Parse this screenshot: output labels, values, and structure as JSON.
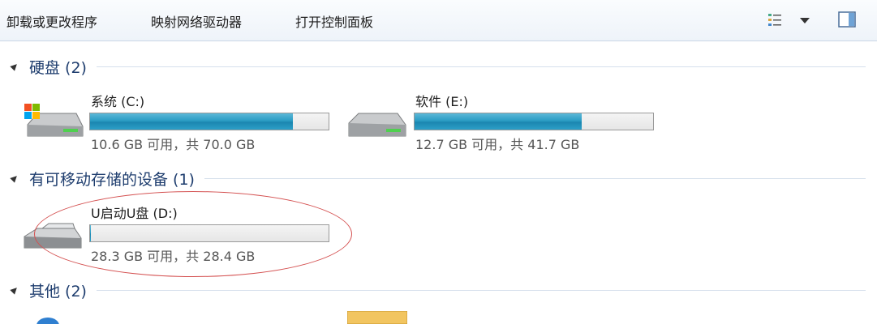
{
  "toolbar": {
    "uninstall": "卸载或更改程序",
    "map_drive": "映射网络驱动器",
    "control_panel": "打开控制面板"
  },
  "groups": {
    "hard_disk": "硬盘 (2)",
    "removable": "有可移动存储的设备 (1)",
    "other": "其他 (2)"
  },
  "drives": [
    {
      "name": "系统 (C:)",
      "size_text": "10.6 GB 可用，共 70.0 GB",
      "used_fraction": 0.85
    },
    {
      "name": "软件 (E:)",
      "size_text": "12.7 GB 可用，共 41.7 GB",
      "used_fraction": 0.7
    },
    {
      "name": "U启动U盘 (D:)",
      "size_text": "28.3 GB 可用，共 28.4 GB",
      "used_fraction": 0.004
    }
  ],
  "colors": {
    "accent": "#2b9cc4",
    "group_title": "#1e3d6e",
    "highlight_circle": "#d45050"
  }
}
